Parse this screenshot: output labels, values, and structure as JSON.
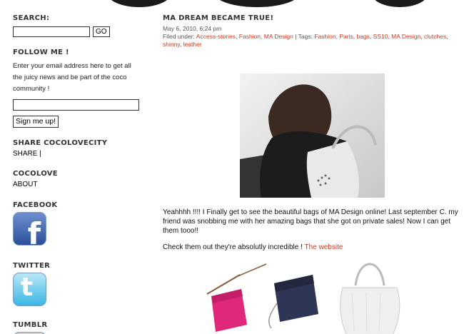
{
  "sidebar": {
    "search_heading": "SEARCH:",
    "go_label": "GO",
    "follow_heading": "FOLLOW ME !",
    "follow_text": "Enter your email address here to get all the juicy news and be part of the coco community !",
    "signup_label": "Sign me up!",
    "share_heading": "SHARE COCOLOVECITY",
    "share_link": "SHARE |",
    "cocolove_heading": "COCOLOVE",
    "about_link": "ABOUT",
    "facebook_heading": "FACEBOOK",
    "twitter_heading": "TWITTER",
    "tumblr_heading": "TUMBLR"
  },
  "post": {
    "title": "MA DREAM BECAME TRUE!",
    "date": "May 6, 2010, 6:24 pm",
    "filed_under_label": "Filed under:",
    "categories": [
      "Access-stories",
      "Fashion",
      "MA Design"
    ],
    "tags_label": "| Tags:",
    "tags": [
      "Fashion",
      "Paris",
      "bags",
      "SS10",
      "MA Design",
      "clutches",
      "shinny",
      "leather"
    ],
    "paragraph1": "Yeahhhh !!!! I Finally get to see the beautiful bags of MA Design online! Last september C. my friend was snobbing me with her amazing bags that she got on private sales! Now I can get them tooo!!",
    "paragraph2": "Check them out they're absolutly incredible !",
    "website_link": "The website"
  },
  "colors": {
    "accent": "#d0381d",
    "heading": "#333333"
  }
}
